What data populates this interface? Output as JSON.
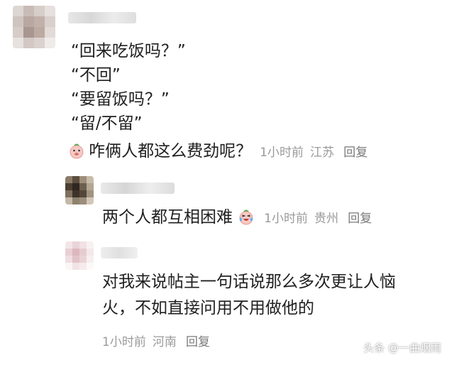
{
  "comment": {
    "quotes": [
      "“回来吃饭吗？”",
      "“不回”",
      "“要留饭吗？”",
      "“留/不留”"
    ],
    "text": "咋俩人都这么费劲呢？",
    "time": "1小时前",
    "location": "江苏",
    "reply_label": "回复",
    "emoji": "pig-face-icon"
  },
  "replies": [
    {
      "text": "两个人都互相困难",
      "time": "1小时前",
      "location": "贵州",
      "reply_label": "回复",
      "emoji": "crying-laughing-pig-icon"
    },
    {
      "text_line1": "对我来说帖主一句话说那么多次更让人恼",
      "text_line2": "火，不如直接问用不用做他的",
      "time": "1小时前",
      "location": "河南",
      "reply_label": "回复"
    }
  ],
  "watermark": "头条 @一曲烟雨"
}
